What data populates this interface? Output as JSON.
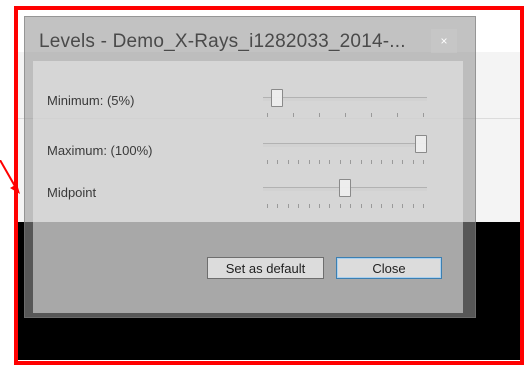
{
  "dialog": {
    "title": "Levels - Demo_X-Rays_i1282033_2014-...",
    "close_glyph": "×"
  },
  "sliders": [
    {
      "label": "Minimum: (5%)",
      "value_percent": 5
    },
    {
      "label": "Maximum: (100%)",
      "value_percent": 100
    },
    {
      "label": "Midpoint",
      "value_percent": 50
    }
  ],
  "buttons": {
    "set_default": "Set as default",
    "close": "Close"
  },
  "colors": {
    "highlight": "#ff0000",
    "default_button_border": "#3c7fb1"
  },
  "icons": {
    "arrow": "red-arrow-icon",
    "close": "close-icon"
  }
}
